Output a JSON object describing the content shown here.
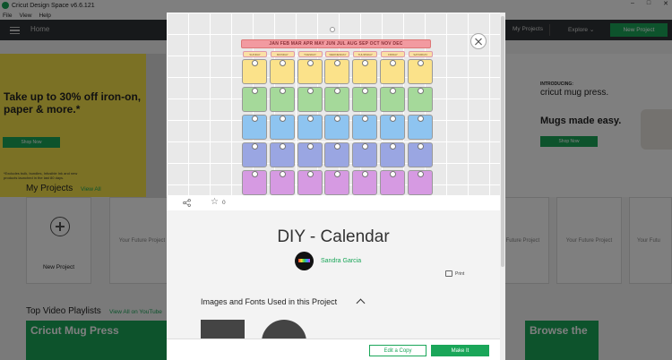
{
  "window": {
    "title": "Cricut Design Space  v6.6.121",
    "menu": [
      "File",
      "View",
      "Help"
    ]
  },
  "header": {
    "home_label": "Home",
    "my_projects": "My Projects",
    "explore": "Explore",
    "new_project": "New Project"
  },
  "banners": {
    "left": {
      "headline": "Take up to 30% off iron-on, paper & more.*",
      "button": "Shop Now",
      "fine_print": "*Excludes bulk, bundles, Infusible Ink and new products launched in the last 80 days."
    },
    "right": {
      "intro": "INTRODUCING:",
      "brand": "cricut mug press.",
      "headline": "Mugs made easy.",
      "button": "Shop Now"
    }
  },
  "my_projects": {
    "title": "My Projects",
    "view_all": "View All",
    "new_project": "New Project",
    "future_label": "Your Future Project",
    "future_label_short": "Your Futu"
  },
  "videos": {
    "title": "Top Video Playlists",
    "view_all": "View All on YouTube",
    "left_card": "Cricut Mug Press",
    "right_card": "Browse the"
  },
  "modal": {
    "months": "JAN FEB MAR APR MAY JUN JUL AUG SEP OCT NOV DEC",
    "days": [
      "SUNDAY",
      "MONDAY",
      "TUESDAY",
      "WEDNESDAY",
      "THURSDAY",
      "FRIDAY",
      "SATURDAY"
    ],
    "row_colors": [
      "#fbe28a",
      "#a5d99a",
      "#8ec4f0",
      "#9aa6e2",
      "#d69ae2"
    ],
    "star_count": "0",
    "project_title": "DIY - Calendar",
    "author": "Sandra Garcia",
    "print_label": "Print",
    "images_fonts_heading": "Images and Fonts Used in this Project",
    "edit_copy": "Edit a Copy",
    "make_it": "Make It"
  },
  "colors": {
    "accent": "#1aa659",
    "header_bg": "#2e3336"
  }
}
